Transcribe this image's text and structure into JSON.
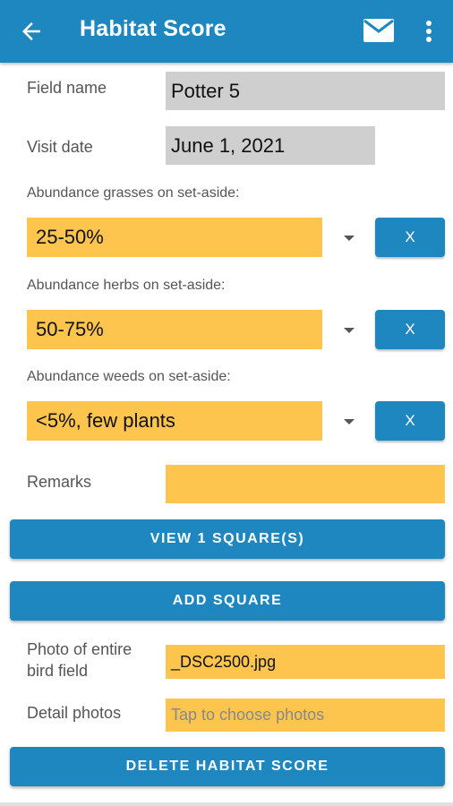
{
  "appbar": {
    "title": "Habitat Score",
    "back_icon": "arrow-left-icon",
    "mail_icon": "mail-icon",
    "more_icon": "more-vert-icon"
  },
  "form": {
    "field_name": {
      "label": "Field name",
      "value": "Potter 5"
    },
    "visit_date": {
      "label": "Visit date",
      "value": "June 1, 2021"
    },
    "grasses": {
      "label": "Abundance grasses on set-aside:",
      "value": "25-50%",
      "clear": "X"
    },
    "herbs": {
      "label": "Abundance herbs on set-aside:",
      "value": "50-75%",
      "clear": "X"
    },
    "weeds": {
      "label": "Abundance weeds on set-aside:",
      "value": "<5%, few plants",
      "clear": "X"
    },
    "remarks": {
      "label": "Remarks",
      "value": ""
    },
    "photo": {
      "label_line1": "Photo of entire",
      "label_line2": "bird field",
      "value": "_DSC2500.jpg"
    },
    "detail_photos": {
      "label": "Detail photos",
      "placeholder": "Tap to choose photos"
    }
  },
  "buttons": {
    "view_squares": "VIEW 1 SQUARE(S)",
    "add_square": "ADD SQUARE",
    "delete": "DELETE HABITAT SCORE"
  },
  "colors": {
    "primary": "#1f87c0",
    "field_yellow": "#fec54e",
    "field_gray": "#cfcfcf"
  }
}
